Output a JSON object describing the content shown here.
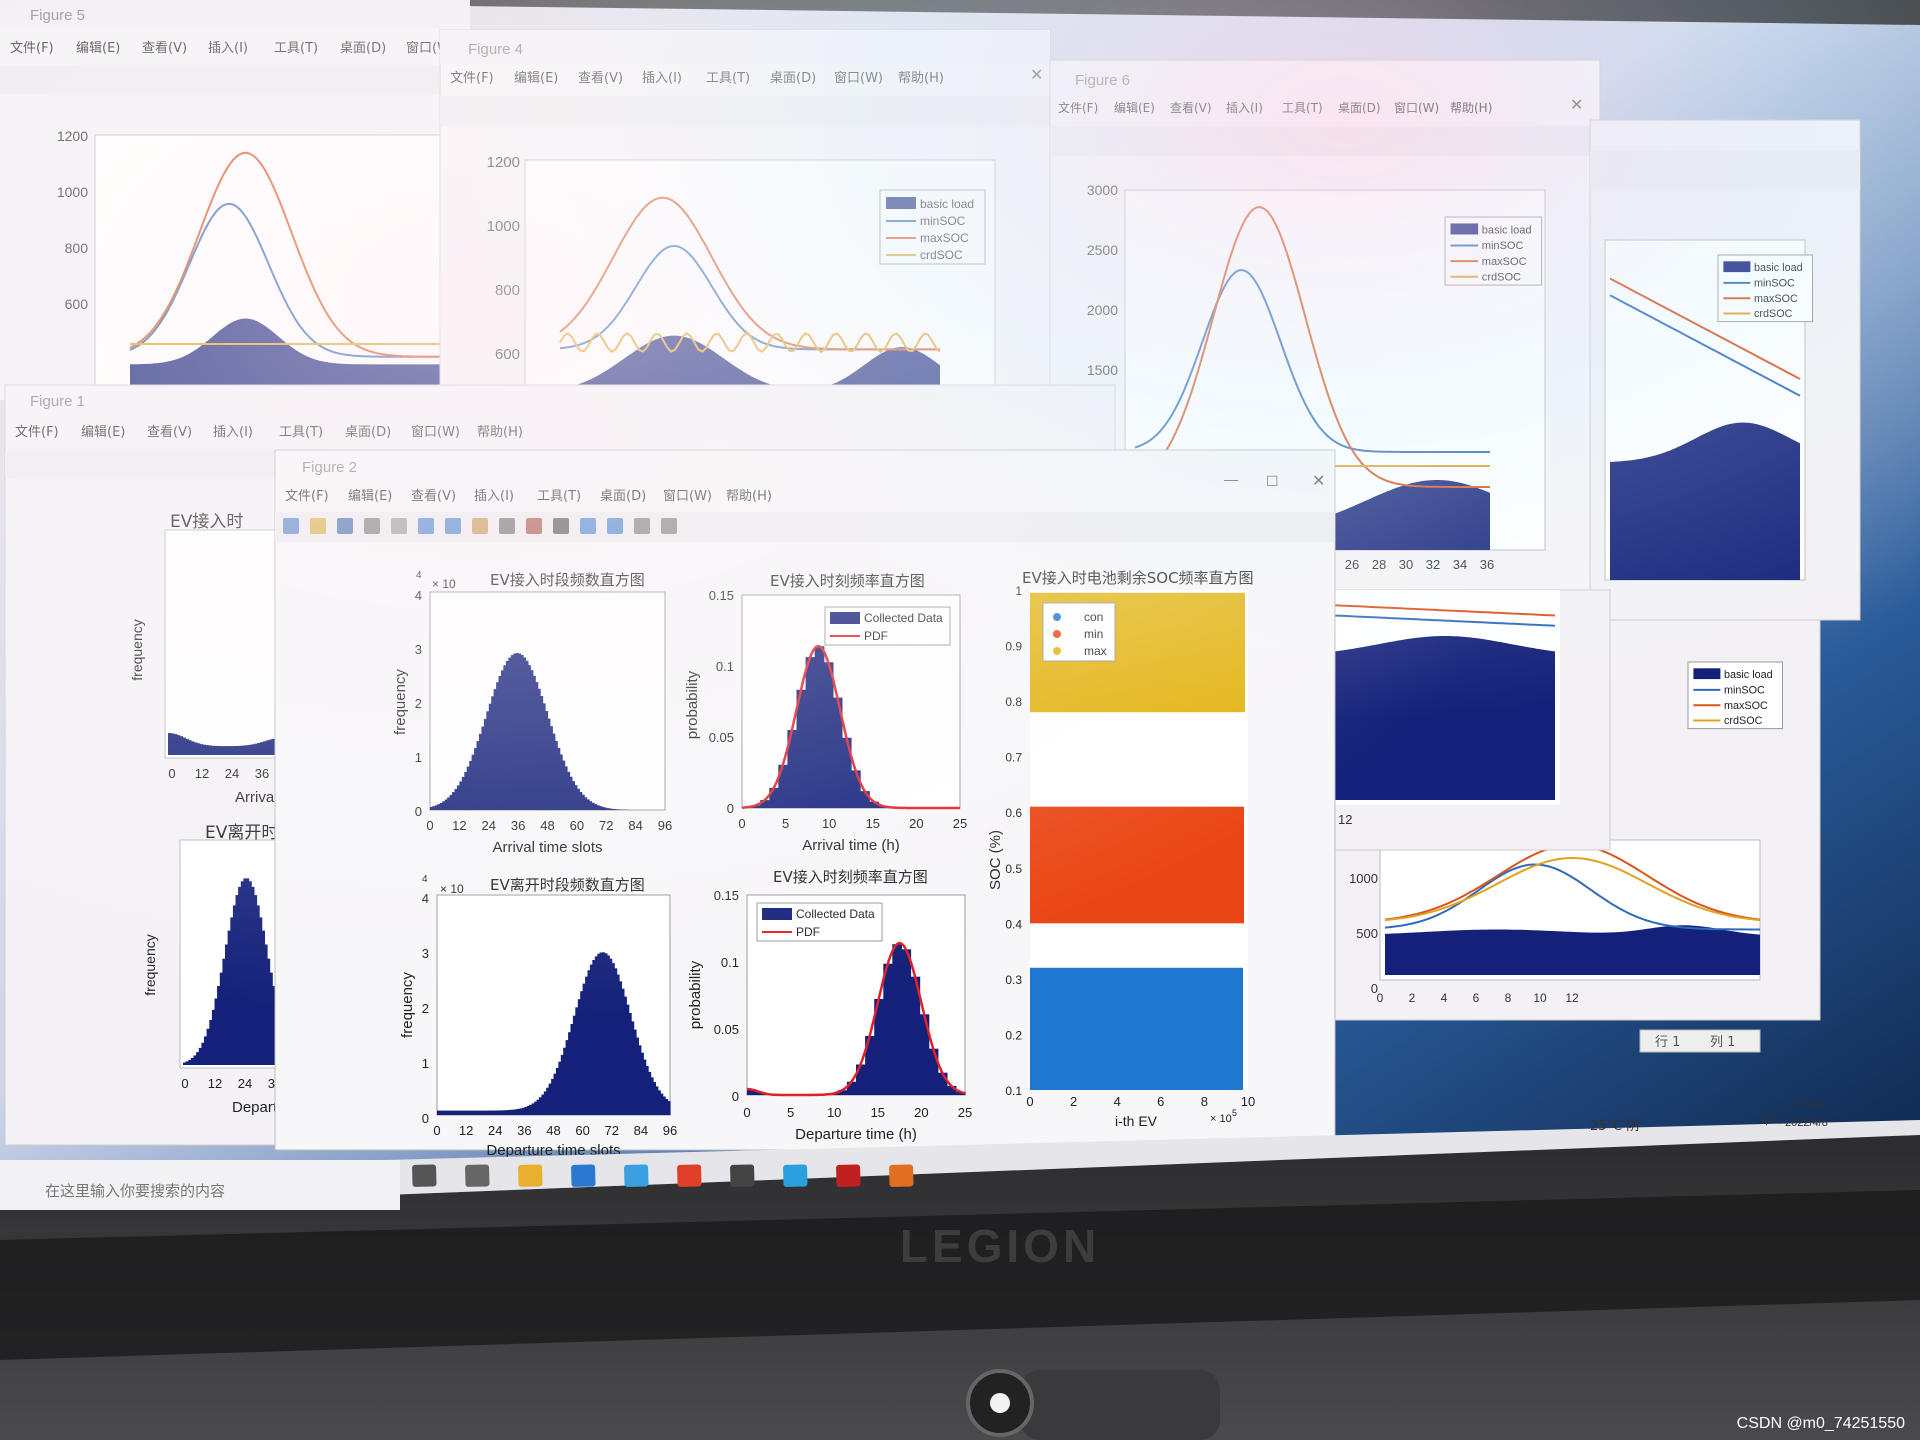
{
  "colors": {
    "basic_load": "#14217a",
    "minSOC": "#2f6ab8",
    "maxSOC": "#d9541f",
    "crdSOC": "#e0a020",
    "pdf": "#e0202a",
    "soc_con": "#1e78d0",
    "soc_min": "#ea4514",
    "soc_max": "#e3b412",
    "titlebar_text": "#888888"
  },
  "windows": [
    {
      "id": "fig5",
      "title": "Figure 5"
    },
    {
      "id": "fig4",
      "title": "Figure 4"
    },
    {
      "id": "fig6",
      "title": "Figure 6"
    },
    {
      "id": "fig1",
      "title": "Figure 1"
    },
    {
      "id": "fig2",
      "title": "Figure 2"
    }
  ],
  "menu_items": [
    "文件(F)",
    "编辑(E)",
    "查看(V)",
    "插入(I)",
    "工具(T)",
    "桌面(D)",
    "窗口(W)",
    "帮助(H)"
  ],
  "load_legend": [
    "basic load",
    "minSOC",
    "maxSOC",
    "crdSOC"
  ],
  "fig4": {
    "y_ticks": [
      "1200",
      "1000",
      "800",
      "600"
    ]
  },
  "fig6": {
    "y_ticks": [
      "3000",
      "2500",
      "2000",
      "1500"
    ],
    "x_ticks": [
      "26",
      "28",
      "30",
      "32",
      "34",
      "36"
    ]
  },
  "fig5": {
    "y_ticks": [
      "1200",
      "1000",
      "800",
      "600"
    ]
  },
  "br": {
    "y_ticks": [
      "1000",
      "500",
      "0"
    ],
    "x_ticks": [
      "0",
      "2",
      "4",
      "6",
      "8",
      "10",
      "12"
    ],
    "status_row": "行 1",
    "status_col": "列 1",
    "side_tick": "12"
  },
  "fig1": {
    "top_title": "EV接入时",
    "bottom_title": "EV离开时",
    "ylabel": "frequency",
    "top_x_ticks": [
      "0",
      "12",
      "24",
      "36"
    ],
    "top_xlabel": "Arriva",
    "bottom_x_ticks": [
      "0",
      "12",
      "24",
      "36"
    ],
    "bottom_xlabel": "Departu"
  },
  "fig2": {
    "arr_slots_title": "EV接入时段频数直方图",
    "dep_slots_title": "EV离开时段频数直方图",
    "arr_prob_title": "EV接入时刻频率直方图",
    "dep_prob_title": "EV接入时刻频率直方图",
    "soc_title": "EV接入时电池剩余SOC频率直方图",
    "freq_ylabel": "frequency",
    "prob_ylabel": "probability",
    "slot_x_ticks": [
      "0",
      "12",
      "24",
      "36",
      "48",
      "60",
      "72",
      "84",
      "96"
    ],
    "slot_y_ticks": [
      "4",
      "3",
      "2",
      "1",
      "0"
    ],
    "exp_label": "× 10",
    "exp_sup": "4",
    "arr_slots_xlabel": "Arrival time slots",
    "dep_slots_xlabel": "Departure time slots",
    "hour_x_ticks": [
      "0",
      "5",
      "10",
      "15",
      "20",
      "25"
    ],
    "prob_y_ticks": [
      "0.15",
      "0.1",
      "0.05",
      "0"
    ],
    "arr_prob_xlabel": "Arrival time (h)",
    "dep_prob_xlabel": "Departure time (h)",
    "pdf_legend": [
      "Collected Data",
      "PDF"
    ],
    "soc_legend": [
      "con",
      "min",
      "max"
    ],
    "soc_ylabel": "SOC (%)",
    "soc_y_ticks": [
      "1",
      "0.9",
      "0.8",
      "0.7",
      "0.6",
      "0.5",
      "0.4",
      "0.3",
      "0.2",
      "0.1"
    ],
    "soc_x_ticks": [
      "0",
      "2",
      "4",
      "6",
      "8",
      "10"
    ],
    "soc_xlabel": "i-th EV",
    "soc_x_exp": "× 10",
    "soc_x_exp_sup": "5"
  },
  "taskbar": {
    "search_placeholder": "在这里输入你要搜索的内容",
    "weather": "25°C 阴",
    "ime": "中",
    "time": "17:08",
    "date": "2022/4/8"
  },
  "laptop_brand": "LEGION",
  "watermark": "CSDN @m0_74251550"
}
